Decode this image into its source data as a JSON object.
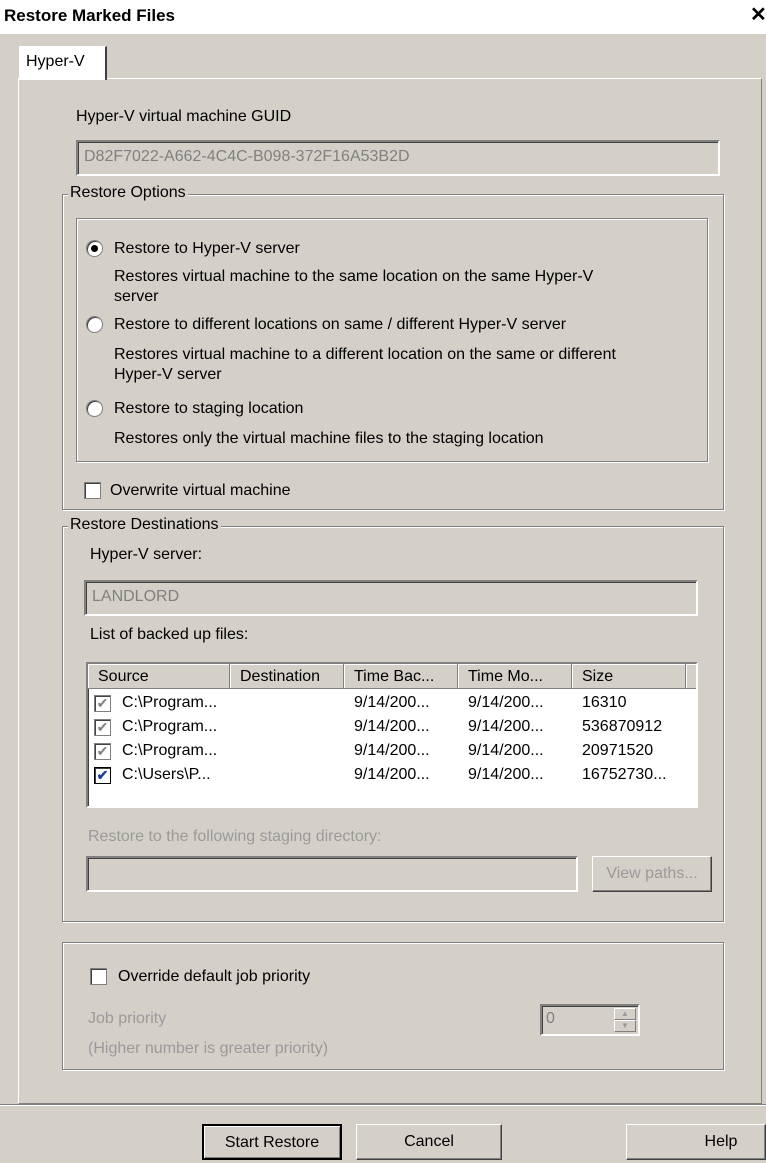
{
  "window": {
    "title": "Restore Marked Files",
    "close_glyph": "✕"
  },
  "tabs": [
    {
      "label": "Hyper-V"
    }
  ],
  "guid": {
    "label": "Hyper-V virtual machine GUID",
    "value": "D82F7022-A662-4C4C-B098-372F16A53B2D"
  },
  "restore_options": {
    "legend": "Restore Options",
    "options": [
      {
        "label": "Restore to Hyper-V server",
        "desc_line1": "Restores virtual machine to the same location on the same Hyper-V",
        "desc_line2": "server",
        "selected": true
      },
      {
        "label": "Restore to different locations on same / different Hyper-V server",
        "desc_line1": "Restores virtual machine to a different location on the same or different",
        "desc_line2": "Hyper-V server",
        "selected": false
      },
      {
        "label": "Restore to staging location",
        "desc_line1": "Restores only the virtual machine files to the staging location",
        "desc_line2": "",
        "selected": false
      }
    ],
    "overwrite_label": "Overwrite virtual machine"
  },
  "restore_destinations": {
    "legend": "Restore Destinations",
    "server_label": "Hyper-V server:",
    "server_value": "LANDLORD",
    "files_label": "List of backed up files:",
    "columns": [
      "Source",
      "Destination",
      "Time Bac...",
      "Time Mo...",
      "Size"
    ],
    "rows": [
      {
        "source": "C:\\Program...",
        "destination": "",
        "time_backed": "9/14/200...",
        "time_modified": "9/14/200...",
        "size": "16310",
        "checked": true,
        "enabled": false
      },
      {
        "source": "C:\\Program...",
        "destination": "",
        "time_backed": "9/14/200...",
        "time_modified": "9/14/200...",
        "size": "536870912",
        "checked": true,
        "enabled": false
      },
      {
        "source": "C:\\Program...",
        "destination": "",
        "time_backed": "9/14/200...",
        "time_modified": "9/14/200...",
        "size": "20971520",
        "checked": true,
        "enabled": false
      },
      {
        "source": "C:\\Users\\P...",
        "destination": "",
        "time_backed": "9/14/200...",
        "time_modified": "9/14/200...",
        "size": "16752730...",
        "checked": true,
        "enabled": true
      }
    ],
    "staging_label": "Restore to the following staging directory:",
    "staging_value": "",
    "view_paths_label": "View paths..."
  },
  "priority": {
    "override_label": "Override default job priority",
    "job_priority_label": "Job priority",
    "job_priority_value": "0",
    "hint": "(Higher number is greater priority)"
  },
  "buttons": {
    "start": "Start Restore",
    "cancel": "Cancel",
    "help": "Help"
  },
  "colors": {
    "dialog_bg": "#d4d0c8",
    "check_blue": "#1a3f9a",
    "disabled_text": "#9a9a9a"
  }
}
